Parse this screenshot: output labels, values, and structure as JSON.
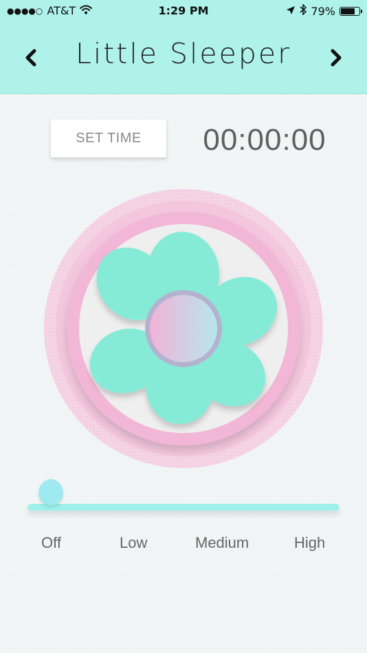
{
  "status_bar": {
    "carrier": "AT&T",
    "signal_dots": "●●●●○",
    "time": "1:29 PM",
    "battery_percent": "79%",
    "battery_level": 0.79,
    "icons": [
      "signal-dots-icon",
      "wifi-icon",
      "location-arrow-icon",
      "bluetooth-icon",
      "battery-icon"
    ]
  },
  "nav": {
    "title": "Little Sleeper",
    "prev_icon": "chevron-left-icon",
    "next_icon": "chevron-right-icon"
  },
  "timer": {
    "button_label": "SET TIME",
    "display": "00:00:00"
  },
  "fan": {
    "icon": "fan-icon",
    "blade_color": "#86ebd6",
    "ring_color": "#f3b6d6",
    "hub_colors": [
      "#f2b7d8",
      "#b9e4ef"
    ]
  },
  "speed": {
    "levels": [
      "Off",
      "Low",
      "Medium",
      "High"
    ],
    "selected": "Off",
    "selected_index": 0,
    "track_color": "#9ef0ea"
  },
  "colors": {
    "header_bg": "#aef2ea",
    "main_bg": "#f1f5f5"
  }
}
